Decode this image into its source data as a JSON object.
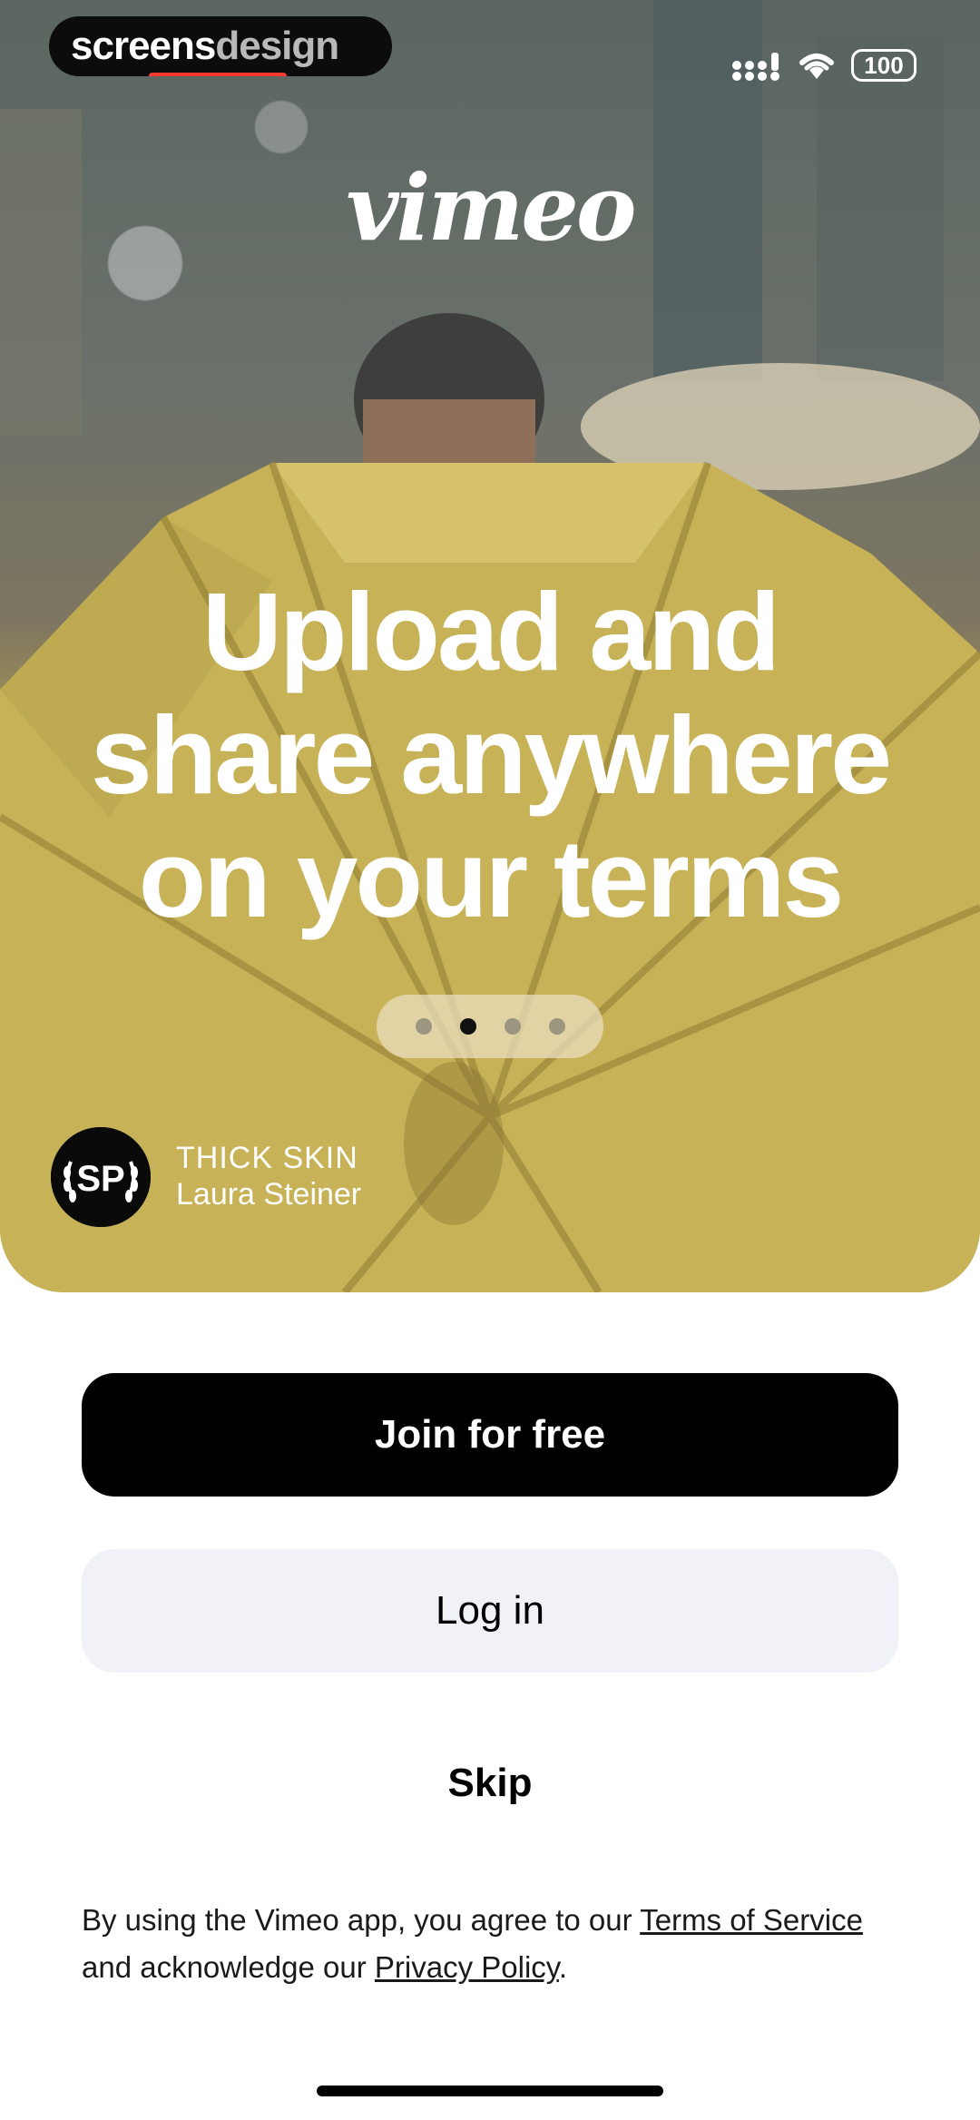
{
  "watermark": {
    "part1": "screens",
    "part2": "design"
  },
  "status_bar": {
    "battery": "100"
  },
  "hero": {
    "logo": "vimeo",
    "headline": [
      "Upload and",
      "share anywhere",
      "on your terms"
    ],
    "carousel": {
      "total": 4,
      "active_index": 2
    },
    "credit": {
      "avatar_initials": "SP",
      "title": "THICK SKIN",
      "author": "Laura Steiner"
    }
  },
  "actions": {
    "join_label": "Join for free",
    "login_label": "Log in",
    "skip_label": "Skip"
  },
  "legal": {
    "prefix": "By using the Vimeo app, you agree to our ",
    "terms_link": "Terms of Service",
    "middle": " and acknowledge our ",
    "privacy_link": "Privacy Policy",
    "suffix": "."
  },
  "colors": {
    "accent_yellow": "#c9b455",
    "button_dark": "#000000",
    "button_light": "#f1f1f8"
  }
}
